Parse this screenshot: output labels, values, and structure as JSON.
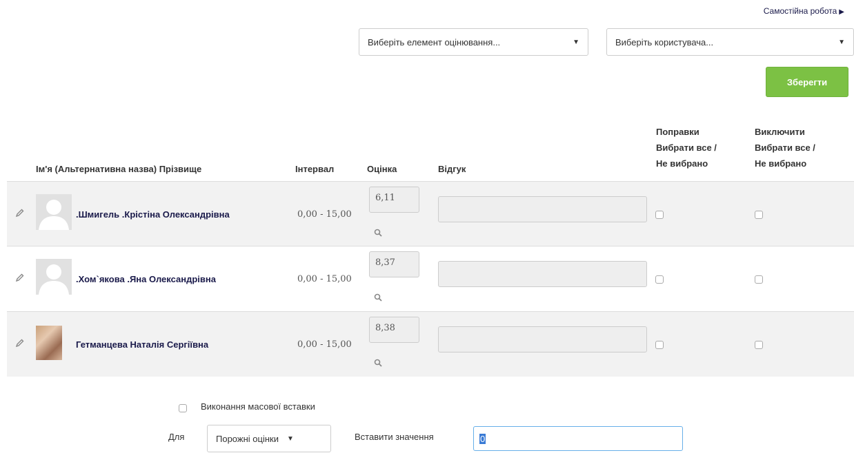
{
  "nav": {
    "next_label": "Самостійна робота",
    "next_arrow": "▶"
  },
  "filters": {
    "grade_item": {
      "value": "Виберіть елемент оцінювання...",
      "caret": "▼"
    },
    "user": {
      "value": "Виберіть користувача...",
      "caret": "▼"
    }
  },
  "save_label": "Зберегти",
  "table": {
    "headers": {
      "name": "Ім'я (Альтернативна назва) Прізвище",
      "interval": "Інтервал",
      "grade": "Оцінка",
      "feedback": "Відгук",
      "override_title": "Поправки",
      "override_select_all": "Вибрати все /",
      "override_select_none": "Не вибрано",
      "exclude_title": "Виключити",
      "exclude_select_all": "Вибрати все /",
      "exclude_select_none": "Не вибрано"
    },
    "rows": [
      {
        "name": ".Шмигель .Крістіна Олександрівна",
        "interval": "0,00 - 15,00",
        "grade": "6,11",
        "feedback": "",
        "avatar": "default"
      },
      {
        "name": ".Хом`якова .Яна Олександрівна",
        "interval": "0,00 - 15,00",
        "grade": "8,37",
        "feedback": "",
        "avatar": "default"
      },
      {
        "name": "Гетманцева Наталія Сергіївна",
        "interval": "0,00 - 15,00",
        "grade": "8,38",
        "feedback": "",
        "avatar": "photo"
      }
    ]
  },
  "bulk": {
    "label": "Виконання масової вставки",
    "for_label": "Для",
    "for_value": "Порожні оцінки",
    "for_caret": "▼",
    "insert_label": "Вставити значення",
    "insert_value": "0"
  },
  "icons": {
    "edit": "pencil-icon",
    "search": "magnifier-icon",
    "avatar": "user-avatar"
  },
  "colors": {
    "save_button": "#7cc144",
    "row_stripe": "#f2f2f2",
    "link": "#1a1a4a"
  }
}
